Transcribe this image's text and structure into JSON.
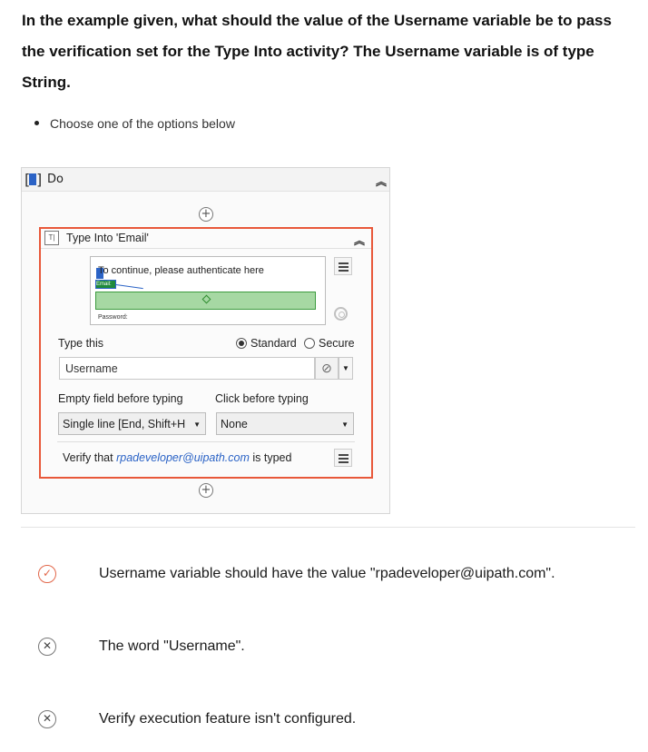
{
  "question": {
    "text": "In the example given, what should the value of the Username variable be to pass the verification set for the Type Into activity? The Username variable is of type String.",
    "instruction": "Choose one of the options below"
  },
  "workflow": {
    "do_title": "Do",
    "type_into": {
      "title": "Type Into 'Email'",
      "preview_text": "To continue, please authenticate here",
      "email_tag": "Email:",
      "password_label": "Password:",
      "type_this_label": "Type this",
      "mode_standard": "Standard",
      "mode_secure": "Secure",
      "selected_mode": "Standard",
      "input_value": "Username",
      "empty_field_label": "Empty field before typing",
      "empty_field_value": "Single line [End, Shift+H",
      "click_before_label": "Click before typing",
      "click_before_value": "None",
      "verify_prefix": "Verify that",
      "verify_value": "rpadeveloper@uipath.com",
      "verify_suffix": "is typed"
    }
  },
  "options": [
    {
      "text": "Username variable should have the value \"rpadeveloper@uipath.com\".",
      "icon": "check-circle-icon",
      "state": "correct"
    },
    {
      "text": "The word \"Username\".",
      "icon": "x-circle-icon",
      "state": "incorrect"
    },
    {
      "text": "Verify execution feature isn't configured.",
      "icon": "x-circle-icon",
      "state": "incorrect"
    }
  ],
  "colors": {
    "highlight": "#e8583a",
    "link": "#2b63c6",
    "correct": "#e2674a"
  }
}
